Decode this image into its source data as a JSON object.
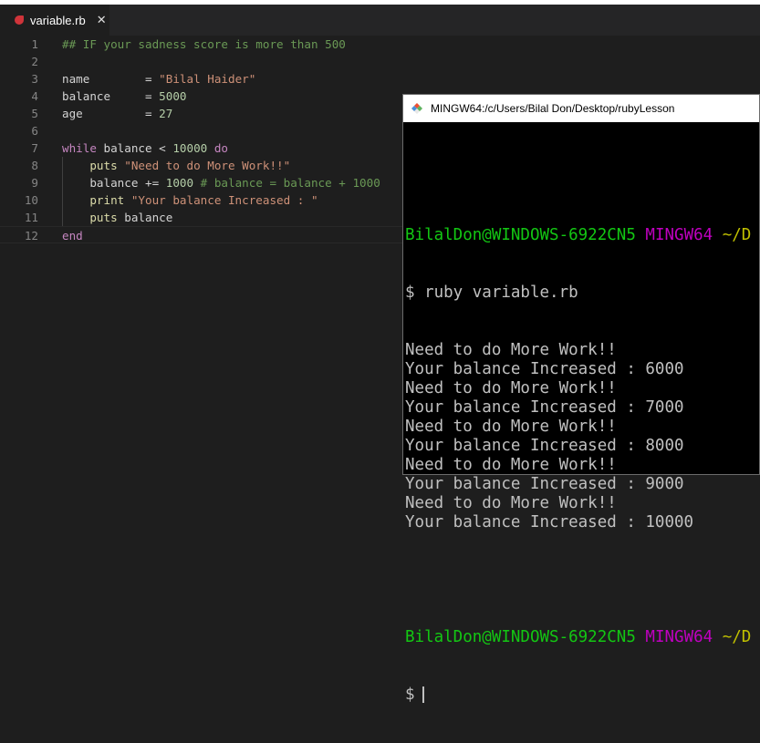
{
  "editor": {
    "tab": {
      "filename": "variable.rb",
      "close": "✕"
    },
    "lines": [
      {
        "n": "1",
        "tokens": [
          {
            "t": "comment",
            "v": "## IF your sadness score is more than 500"
          }
        ]
      },
      {
        "n": "2",
        "tokens": []
      },
      {
        "n": "3",
        "tokens": [
          {
            "t": "var",
            "v": "name        "
          },
          {
            "t": "op",
            "v": "= "
          },
          {
            "t": "str",
            "v": "\"Bilal Haider\""
          }
        ]
      },
      {
        "n": "4",
        "tokens": [
          {
            "t": "var",
            "v": "balance     "
          },
          {
            "t": "op",
            "v": "= "
          },
          {
            "t": "num",
            "v": "5000"
          }
        ]
      },
      {
        "n": "5",
        "tokens": [
          {
            "t": "var",
            "v": "age         "
          },
          {
            "t": "op",
            "v": "= "
          },
          {
            "t": "num",
            "v": "27"
          }
        ]
      },
      {
        "n": "6",
        "tokens": []
      },
      {
        "n": "7",
        "tokens": [
          {
            "t": "kw",
            "v": "while"
          },
          {
            "t": "var",
            "v": " balance < "
          },
          {
            "t": "num",
            "v": "10000"
          },
          {
            "t": "kw",
            "v": " do"
          }
        ]
      },
      {
        "n": "8",
        "tokens": [
          {
            "t": "fn",
            "v": "    puts "
          },
          {
            "t": "str",
            "v": "\"Need to do More Work!!\""
          }
        ]
      },
      {
        "n": "9",
        "tokens": [
          {
            "t": "var",
            "v": "    balance += "
          },
          {
            "t": "num",
            "v": "1000"
          },
          {
            "t": "comment",
            "v": " # balance = balance + 1000"
          }
        ]
      },
      {
        "n": "10",
        "tokens": [
          {
            "t": "fn",
            "v": "    print "
          },
          {
            "t": "str",
            "v": "\"Your balance Increased : \""
          }
        ]
      },
      {
        "n": "11",
        "tokens": [
          {
            "t": "fn",
            "v": "    puts "
          },
          {
            "t": "var",
            "v": "balance"
          }
        ]
      },
      {
        "n": "12",
        "tokens": [
          {
            "t": "kw",
            "v": "end"
          }
        ]
      }
    ]
  },
  "terminal": {
    "title": "MINGW64:/c/Users/Bilal Don/Desktop/rubyLesson",
    "prompt_user": "BilalDon@WINDOWS-6922CN5",
    "prompt_shell": "MINGW64",
    "prompt_path": "~/D",
    "command": "$ ruby variable.rb",
    "output": [
      "Need to do More Work!!",
      "Your balance Increased : 6000",
      "Need to do More Work!!",
      "Your balance Increased : 7000",
      "Need to do More Work!!",
      "Your balance Increased : 8000",
      "Need to do More Work!!",
      "Your balance Increased : 9000",
      "Need to do More Work!!",
      "Your balance Increased : 10000"
    ],
    "dollar": "$"
  }
}
